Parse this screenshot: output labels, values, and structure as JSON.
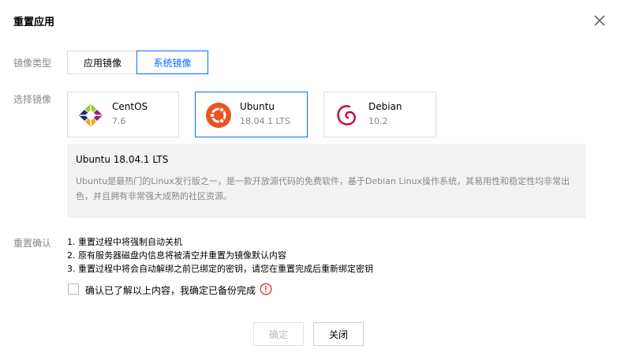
{
  "dialog": {
    "title": "重置应用",
    "close_icon": "close-icon"
  },
  "image_type": {
    "label": "镜像类型",
    "options": [
      {
        "label": "应用镜像",
        "selected": false
      },
      {
        "label": "系统镜像",
        "selected": true
      }
    ]
  },
  "image_select": {
    "label": "选择镜像",
    "images": [
      {
        "name": "CentOS",
        "version": "7.6",
        "icon": "centos-logo-icon",
        "selected": false
      },
      {
        "name": "Ubuntu",
        "version": "18.04.1 LTS",
        "icon": "ubuntu-logo-icon",
        "selected": true
      },
      {
        "name": "Debian",
        "version": "10.2",
        "icon": "debian-logo-icon",
        "selected": false
      }
    ]
  },
  "description": {
    "title": "Ubuntu 18.04.1 LTS",
    "text": "Ubuntu是最热门的Linux发行版之一，是一款开放源代码的免费软件，基于Debian Linux操作系统，其易用性和稳定性均非常出色，并且拥有非常强大成熟的社区资源。"
  },
  "confirm": {
    "label": "重置确认",
    "notes": [
      "1. 重置过程中将强制自动关机",
      "2. 原有服务器磁盘内信息将被清空并重置为镜像默认内容",
      "3. 重置过程中将会自动解绑之前已绑定的密钥，请您在重置完成后重新绑定密钥"
    ],
    "checkbox_label": "确认已了解以上内容，我确定已备份完成",
    "checkbox_checked": false,
    "warning_icon": "warning-icon"
  },
  "footer": {
    "ok_label": "确定",
    "cancel_label": "关闭"
  },
  "colors": {
    "accent": "#006eff",
    "warning": "#e54545"
  }
}
